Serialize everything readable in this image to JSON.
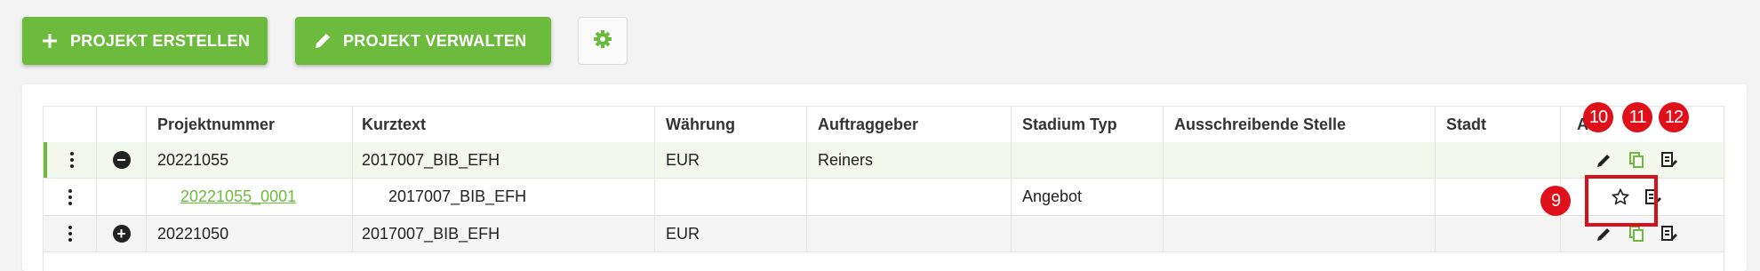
{
  "toolbar": {
    "create_label": "PROJEKT ERSTELLEN",
    "manage_label": "PROJEKT VERWALTEN",
    "create_icon": "plus-icon",
    "manage_icon": "pencil-icon",
    "settings_icon": "gear-icon"
  },
  "colors": {
    "accent": "#6cbb3c",
    "badge": "#e0101a",
    "row_selected": "#f2f8ec"
  },
  "table": {
    "columns": [
      "",
      "",
      "Projektnummer",
      "Kurztext",
      "Währung",
      "Auftraggeber",
      "Stadium Typ",
      "Ausschreibende Stelle",
      "Stadt",
      "Aktionen"
    ],
    "actions_header_visible": "A",
    "rows": [
      {
        "expander": "collapse",
        "projektnummer": "20221055",
        "kurztext": "2017007_BIB_EFH",
        "waehrung": "EUR",
        "auftraggeber": "Reiners",
        "stadium_typ": "",
        "ausschreibende_stelle": "",
        "stadt": ""
      },
      {
        "expander": "",
        "projektnummer": "20221055_0001",
        "kurztext": "2017007_BIB_EFH",
        "waehrung": "",
        "auftraggeber": "",
        "stadium_typ": "Angebot",
        "ausschreibende_stelle": "",
        "stadt": ""
      },
      {
        "expander": "expand",
        "projektnummer": "20221050",
        "kurztext": "2017007_BIB_EFH",
        "waehrung": "EUR",
        "auftraggeber": "",
        "stadium_typ": "",
        "ausschreibende_stelle": "",
        "stadt": ""
      }
    ]
  },
  "annotations": {
    "badges": [
      "9",
      "10",
      "11",
      "12"
    ]
  }
}
